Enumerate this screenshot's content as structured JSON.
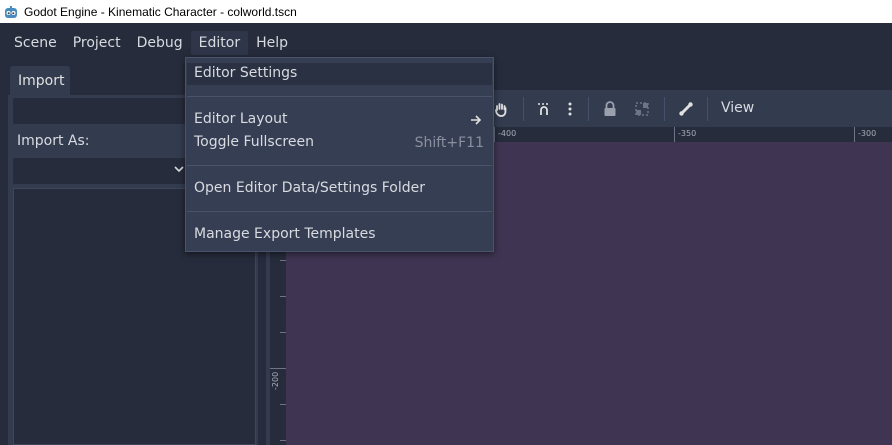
{
  "window": {
    "title": "Godot Engine - Kinematic Character - colworld.tscn"
  },
  "menubar": {
    "items": [
      "Scene",
      "Project",
      "Debug",
      "Editor",
      "Help"
    ]
  },
  "left_dock": {
    "tab_label": "Import",
    "import_as_label": "Import As:"
  },
  "viewport": {
    "view_menu": "View",
    "ruler_top_labels": [
      "-400",
      "-350",
      "-300"
    ],
    "ruler_left_labels": [
      "-200"
    ]
  },
  "editor_menu": {
    "items": [
      {
        "label": "Editor Settings",
        "shortcut": ""
      },
      {
        "label": "Editor Layout",
        "shortcut": ""
      },
      {
        "label": "Toggle Fullscreen",
        "shortcut": "Shift+F11"
      },
      {
        "label": "Open Editor Data/Settings Folder",
        "shortcut": ""
      },
      {
        "label": "Manage Export Templates",
        "shortcut": ""
      }
    ]
  },
  "colors": {
    "background": "#262c3b",
    "panel": "#333b4f",
    "canvas": "#3f3552",
    "accent": "#699ce8"
  }
}
